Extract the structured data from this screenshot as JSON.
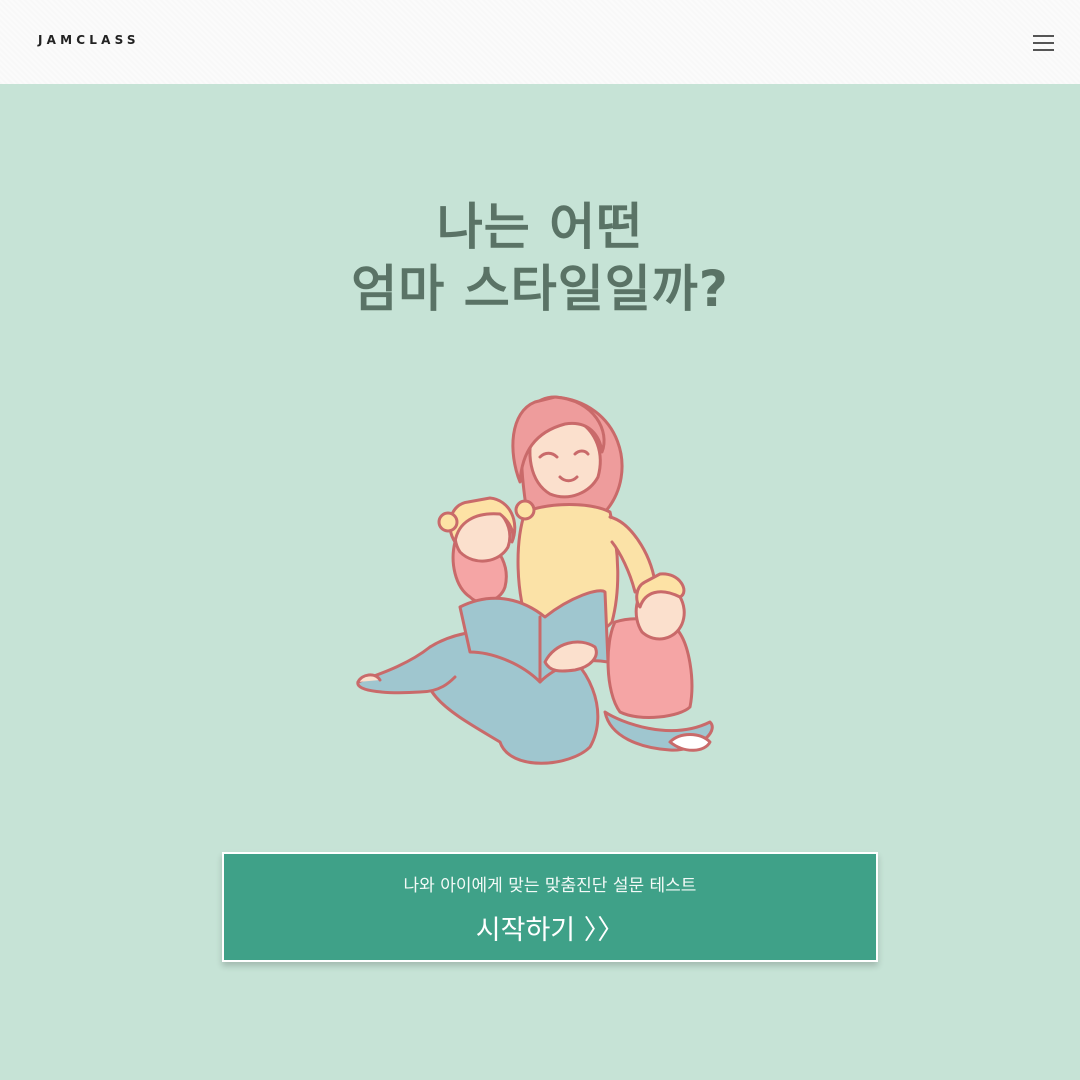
{
  "header": {
    "logo": "JAMCLASS",
    "menu_icon": "hamburger-menu-icon"
  },
  "hero": {
    "title_line1": "나는 어떤",
    "title_line2": "엄마 스타일일까?",
    "illustration": "mother-reading-to-children-illustration"
  },
  "cta": {
    "subtitle": "나와 아이에게 맞는 맞춤진단 설문 테스트",
    "label": "시작하기 〉〉"
  },
  "colors": {
    "background": "#c6e3d6",
    "header": "#fbfbfb",
    "title": "#5a7366",
    "button": "#3fa188"
  }
}
